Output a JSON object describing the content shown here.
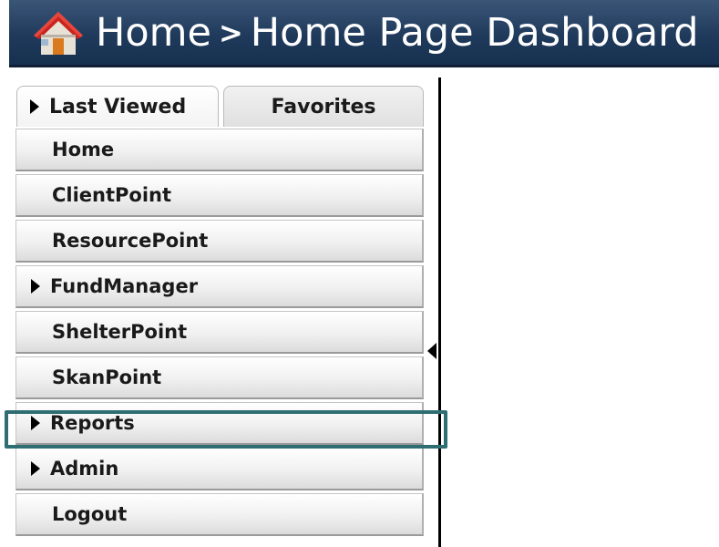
{
  "header": {
    "icon": "house-icon",
    "breadcrumb_root": "Home",
    "separator": ">",
    "current_page": "Home Page Dashboard",
    "background_color": "#203a5c"
  },
  "tabs": [
    {
      "label": "Last Viewed",
      "active": true,
      "has_arrow": true
    },
    {
      "label": "Favorites",
      "active": false,
      "has_arrow": false
    }
  ],
  "menu": {
    "items": [
      {
        "label": "Home",
        "has_submenu": false
      },
      {
        "label": "ClientPoint",
        "has_submenu": false
      },
      {
        "label": "ResourcePoint",
        "has_submenu": false
      },
      {
        "label": "FundManager",
        "has_submenu": true
      },
      {
        "label": "ShelterPoint",
        "has_submenu": false
      },
      {
        "label": "SkanPoint",
        "has_submenu": false
      },
      {
        "label": "Reports",
        "has_submenu": true,
        "highlighted": true
      },
      {
        "label": "Admin",
        "has_submenu": true
      },
      {
        "label": "Logout",
        "has_submenu": false
      }
    ]
  },
  "highlight_color": "#2e6e73"
}
